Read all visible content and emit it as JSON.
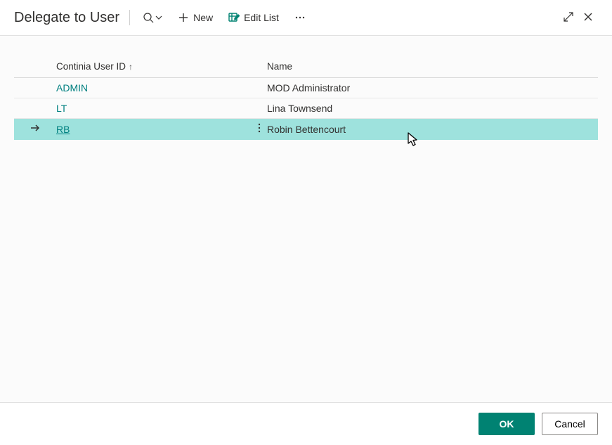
{
  "header": {
    "title": "Delegate to User",
    "new_label": "New",
    "edit_list_label": "Edit List"
  },
  "table": {
    "columns": {
      "id": "Continia User ID",
      "name": "Name"
    },
    "rows": [
      {
        "id": "ADMIN",
        "name": "MOD Administrator",
        "selected": false
      },
      {
        "id": "LT",
        "name": "Lina Townsend",
        "selected": false
      },
      {
        "id": "RB",
        "name": "Robin Bettencourt",
        "selected": true
      }
    ]
  },
  "footer": {
    "ok_label": "OK",
    "cancel_label": "Cancel"
  }
}
